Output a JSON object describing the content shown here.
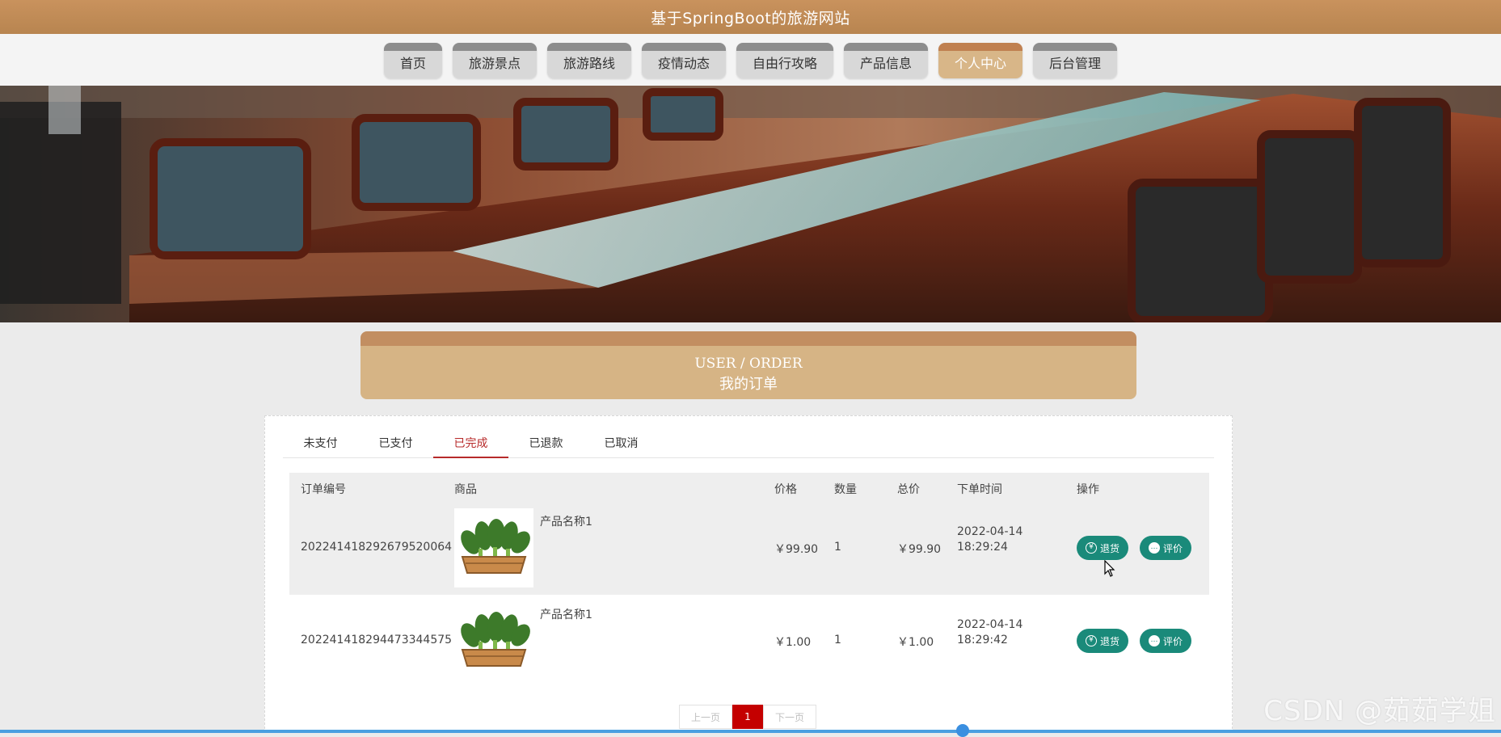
{
  "site": {
    "title": "基于SpringBoot的旅游网站"
  },
  "nav": {
    "items": [
      {
        "label": "首页"
      },
      {
        "label": "旅游景点"
      },
      {
        "label": "旅游路线"
      },
      {
        "label": "疫情动态"
      },
      {
        "label": "自由行攻略"
      },
      {
        "label": "产品信息"
      },
      {
        "label": "个人中心"
      },
      {
        "label": "后台管理"
      }
    ],
    "active": "个人中心"
  },
  "section": {
    "title_en": "USER / ORDER",
    "title_zh": "我的订单"
  },
  "tabs": {
    "items": [
      {
        "label": "未支付"
      },
      {
        "label": "已支付"
      },
      {
        "label": "已完成"
      },
      {
        "label": "已退款"
      },
      {
        "label": "已取消"
      }
    ],
    "active": "已完成"
  },
  "table": {
    "headers": {
      "order_no": "订单编号",
      "product": "商品",
      "price": "价格",
      "qty": "数量",
      "total": "总价",
      "time": "下单时间",
      "action": "操作"
    },
    "rows": [
      {
        "order_no": "202241418292679520064",
        "product_name": "产品名称1",
        "price": "￥99.90",
        "qty": "1",
        "total": "￥99.90",
        "date": "2022-04-14",
        "time": "18:29:24",
        "refund_label": "退货",
        "review_label": "评价"
      },
      {
        "order_no": "202241418294473344575",
        "product_name": "产品名称1",
        "price": "￥1.00",
        "qty": "1",
        "total": "￥1.00",
        "date": "2022-04-14",
        "time": "18:29:42",
        "refund_label": "退货",
        "review_label": "评价"
      }
    ]
  },
  "pager": {
    "prev": "上一页",
    "current": "1",
    "next": "下一页"
  },
  "watermark": "CSDN @茹茹学姐",
  "colors": {
    "header": "#c28e5c",
    "active_nav": "#d8b688",
    "action_button": "#1a8a7a",
    "active_tab": "#b72a2a",
    "pager_current": "#c40000"
  }
}
